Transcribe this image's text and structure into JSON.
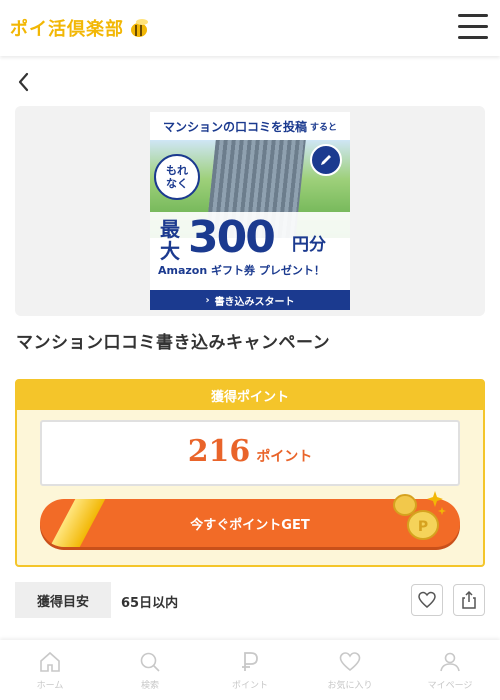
{
  "header": {
    "logo_text": "ポイ活倶楽部",
    "menu_icon": "hamburger-menu-icon"
  },
  "nav": {
    "back_icon": "chevron-left-icon"
  },
  "banner": {
    "headline": "マンションの口コミを投稿",
    "headline_suffix": "すると",
    "badge": "もれなく",
    "max_label": "最大",
    "amount": "300",
    "unit": "円分",
    "gift": "Amazon ギフト券 プレゼント！",
    "cta": "書き込みスタート"
  },
  "campaign": {
    "title": "マンション口コミ書き込みキャンペーン"
  },
  "points": {
    "header": "獲得ポイント",
    "value": "216",
    "unit": "ポイント",
    "get_button": "今すぐポイントGET"
  },
  "meta": {
    "label": "獲得目安",
    "value": "65日以内"
  },
  "actions": {
    "favorite_icon": "heart-icon",
    "share_icon": "share-icon"
  },
  "tabs": [
    {
      "label": "ホーム",
      "icon": "home-icon"
    },
    {
      "label": "検索",
      "icon": "search-icon"
    },
    {
      "label": "ポイント",
      "icon": "point-icon"
    },
    {
      "label": "お気に入り",
      "icon": "heart-icon"
    },
    {
      "label": "マイページ",
      "icon": "user-icon"
    }
  ],
  "colors": {
    "brand": "#f2b705",
    "accent": "#f26b27",
    "points_text": "#e9642a",
    "banner_blue": "#1b3a8f"
  }
}
